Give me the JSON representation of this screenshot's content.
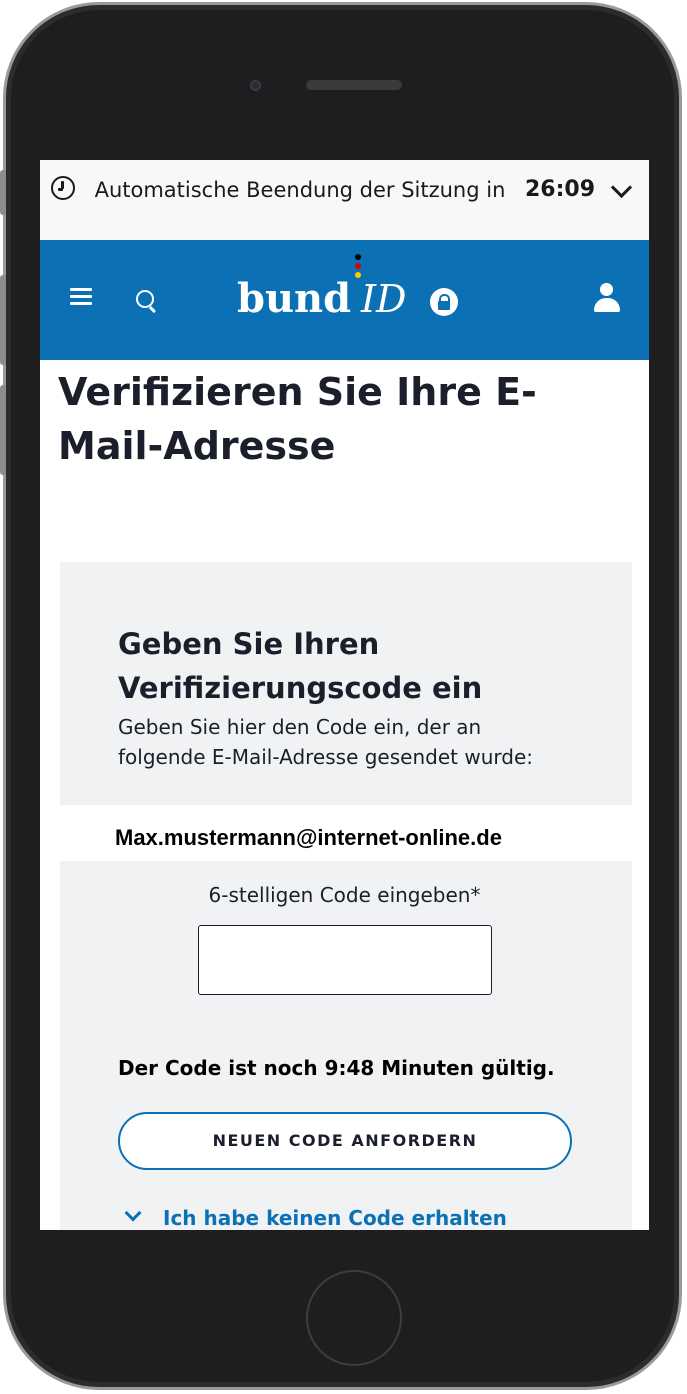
{
  "session": {
    "text": "Automatische Beendung der Sitzung in",
    "time": "26:09"
  },
  "header": {
    "logo_bund": "bund",
    "logo_id": "ID",
    "logo_dot_colors": [
      "#000000",
      "#dd0000",
      "#ffcc00"
    ]
  },
  "page": {
    "title": "Verifizieren Sie Ihre E-Mail-Adresse"
  },
  "card": {
    "title": "Geben Sie Ihren Verifizierungscode ein",
    "description": "Geben Sie hier den Code ein, der an folgende E-Mail-Adresse gesendet wurde:",
    "email": "Max.mustermann@internet-online.de",
    "code_label": "6-stelligen Code eingeben*",
    "code_value": "",
    "validity": "Der Code ist noch 9:48 Minuten gültig.",
    "new_code_button": "NEUEN CODE ANFORDERN",
    "no_code_link": "Ich habe keinen Code erhalten"
  },
  "colors": {
    "brand": "#0b71b4",
    "text": "#1b1f2c",
    "card_bg": "#f1f2f4"
  }
}
